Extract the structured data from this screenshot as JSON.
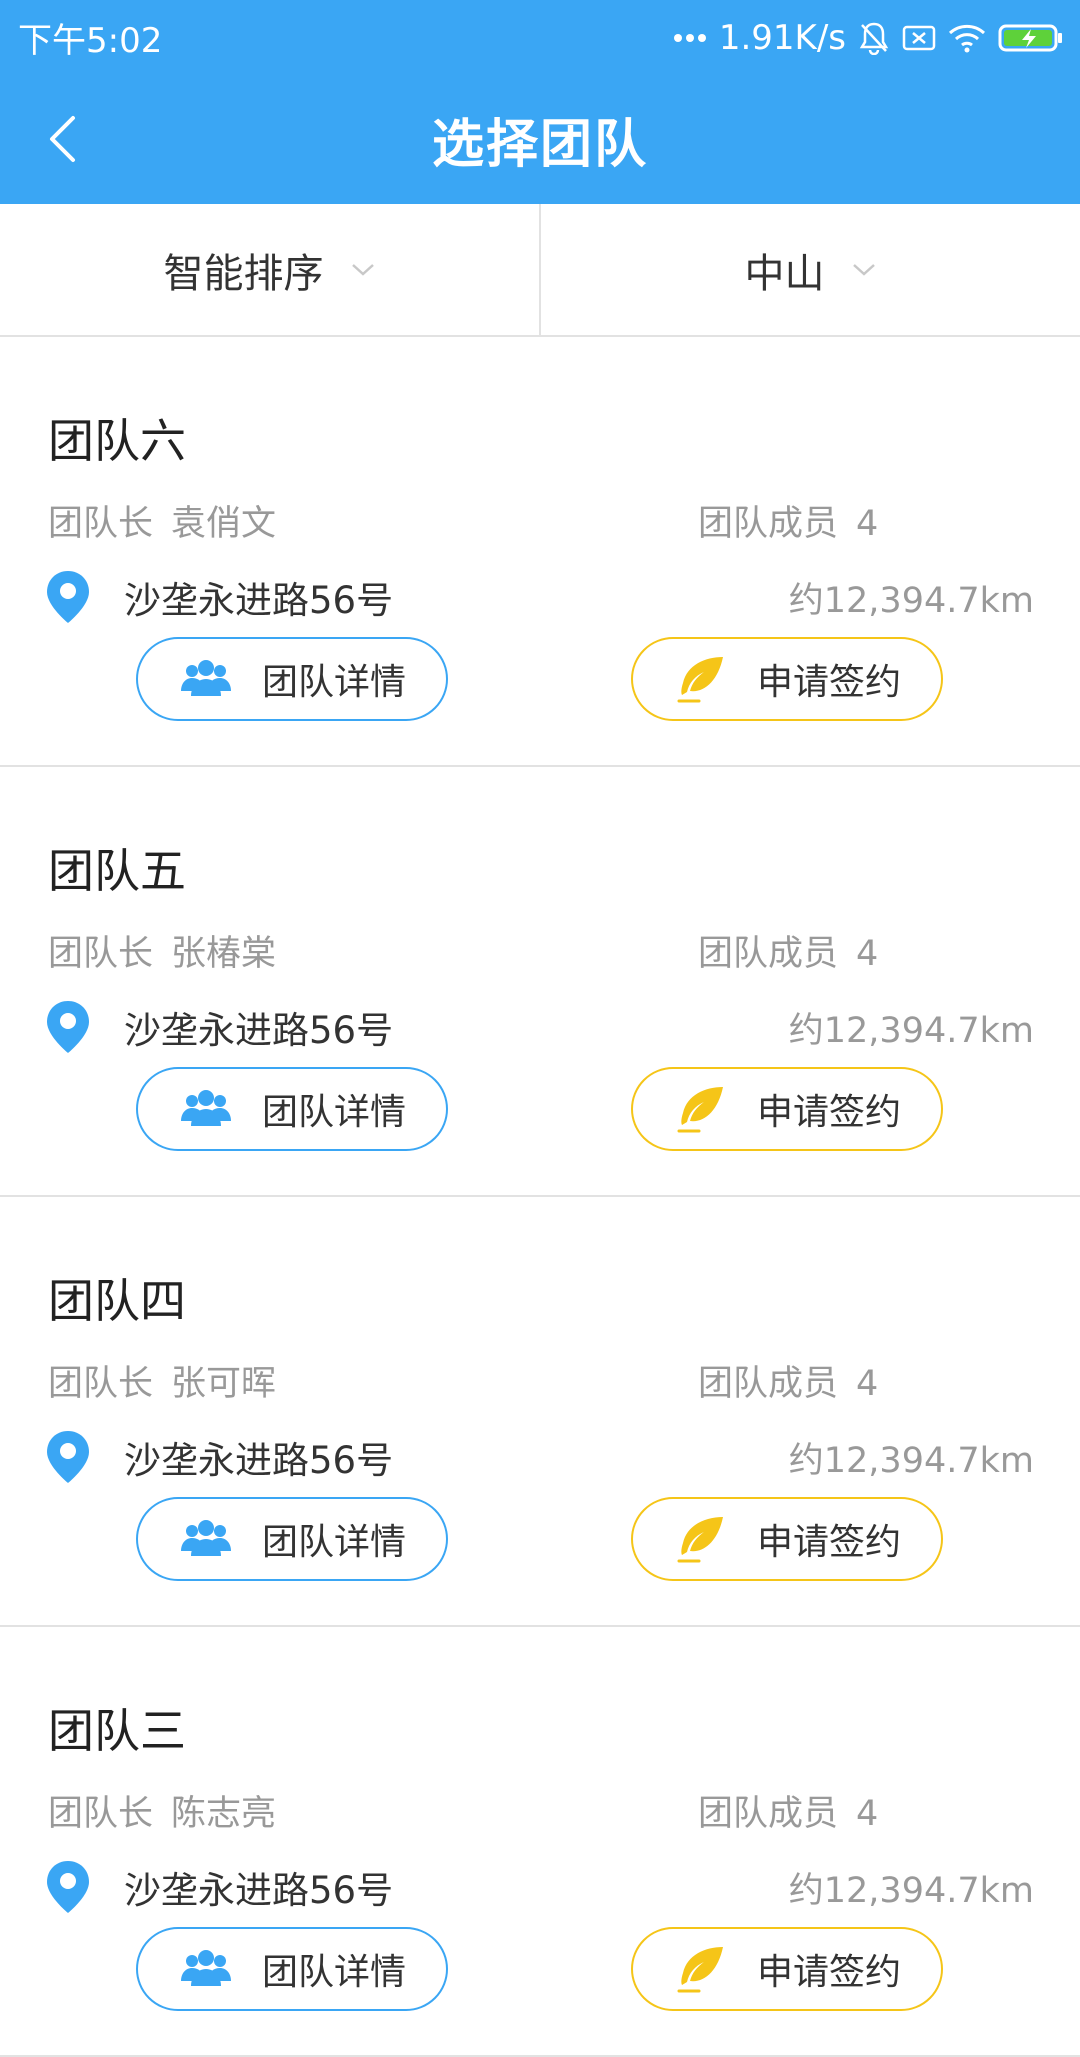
{
  "status_bar": {
    "time": "下午5:02",
    "network_speed": "1.91K/s",
    "icons": [
      "more-dots-icon",
      "mute-icon",
      "sim-off-icon",
      "wifi-icon",
      "battery-charging-icon"
    ]
  },
  "navbar": {
    "back_icon": "chevron-left-icon",
    "title": "选择团队"
  },
  "filters": {
    "sort_label": "智能排序",
    "city_label": "中山"
  },
  "teams": [
    {
      "name": "团队六",
      "leader_label": "团队长",
      "leader": "袁俏文",
      "members_label": "团队成员",
      "members": "4",
      "address": "沙垄永进路56号",
      "distance": "约12,394.7km",
      "detail_label": "团队详情",
      "sign_label": "申请签约"
    },
    {
      "name": "团队五",
      "leader_label": "团队长",
      "leader": "张椿棠",
      "members_label": "团队成员",
      "members": "4",
      "address": "沙垄永进路56号",
      "distance": "约12,394.7km",
      "detail_label": "团队详情",
      "sign_label": "申请签约"
    },
    {
      "name": "团队四",
      "leader_label": "团队长",
      "leader": "张可晖",
      "members_label": "团队成员",
      "members": "4",
      "address": "沙垄永进路56号",
      "distance": "约12,394.7km",
      "detail_label": "团队详情",
      "sign_label": "申请签约"
    },
    {
      "name": "团队三",
      "leader_label": "团队长",
      "leader": "陈志亮",
      "members_label": "团队成员",
      "members": "4",
      "address": "沙垄永进路56号",
      "distance": "约12,394.7km",
      "detail_label": "团队详情",
      "sign_label": "申请签约"
    }
  ],
  "colors": {
    "primary": "#3aa6f4",
    "accent_yellow": "#f5c518",
    "text_primary": "#333333",
    "text_secondary": "#999999"
  }
}
